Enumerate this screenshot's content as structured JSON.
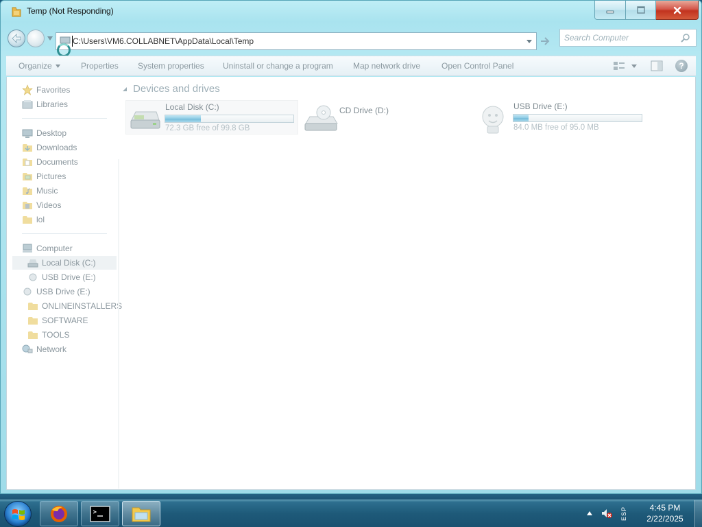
{
  "window": {
    "title": "Temp (Not Responding)",
    "caption_buttons": [
      "minimize-icon",
      "maximize-icon",
      "close-icon"
    ]
  },
  "address": {
    "path": "C:\\Users\\VM6.COLLABNET\\AppData\\Local\\Temp"
  },
  "search": {
    "placeholder": "Search Computer"
  },
  "commands": {
    "organize": "Organize",
    "properties": "Properties",
    "system_properties": "System properties",
    "uninstall": "Uninstall or change a program",
    "map_drive": "Map network drive",
    "control_panel": "Open Control Panel"
  },
  "sidebar": {
    "favorites": "Favorites",
    "libraries": "Libraries",
    "desktop": "Desktop",
    "downloads": "Downloads",
    "documents": "Documents",
    "pictures": "Pictures",
    "music": "Music",
    "videos": "Videos",
    "lol": "lol",
    "computer": "Computer",
    "local_disk": "Local Disk (C:)",
    "usb_sub": "USB Drive (E:)",
    "usb": "USB Drive (E:)",
    "onlineinstallers": "ONLINEINSTALLERS",
    "software": "SOFTWARE",
    "tools": "TOOLS",
    "network": "Network"
  },
  "content": {
    "group_header": "Devices and drives",
    "drives": [
      {
        "name": "Local Disk (C:)",
        "free_text": "72.3 GB free of 99.8 GB",
        "used_fraction": 0.28
      },
      {
        "name": "CD Drive (D:)"
      },
      {
        "name": "USB Drive (E:)",
        "free_text": "84.0 MB free of 95.0 MB",
        "used_fraction": 0.12
      }
    ]
  },
  "taskbar": {
    "apps": [
      "firefox-icon",
      "command-prompt-icon",
      "windows-explorer-icon"
    ],
    "active_app": "windows-explorer-icon",
    "language": "ESP",
    "time": "4:45 PM",
    "date": "2/22/2025"
  },
  "colors": {
    "titlebar": "#a9e3ef",
    "close_button": "#c2331f",
    "taskbar": "#1e5a79",
    "drive_bar_fill": "#8ccbe4"
  }
}
